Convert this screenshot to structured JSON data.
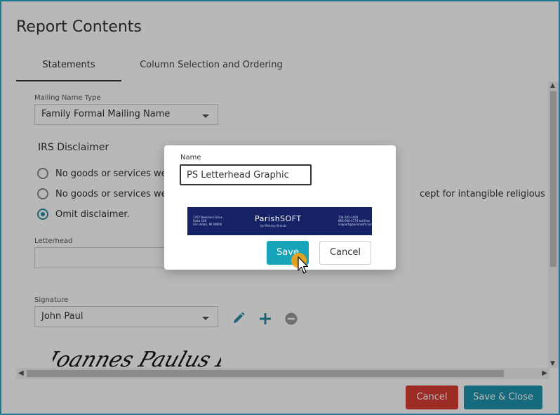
{
  "page": {
    "title": "Report Contents"
  },
  "tabs": [
    {
      "label": "Statements",
      "active": true
    },
    {
      "label": "Column Selection and Ordering",
      "active": false
    }
  ],
  "form": {
    "mailing_name_type": {
      "label": "Mailing Name Type",
      "value": "Family Formal Mailing Name"
    },
    "irs_disclaimer": {
      "title": "IRS Disclaimer",
      "options": [
        {
          "text": "No goods or services were",
          "selected": false
        },
        {
          "text": "No goods or services were",
          "trailing_text": "cept for intangible religious bene",
          "selected": false
        },
        {
          "text": "Omit disclaimer.",
          "selected": true
        }
      ]
    },
    "letterhead": {
      "label": "Letterhead"
    },
    "signature": {
      "label": "Signature",
      "value": "John Paul",
      "image_text": "Ioannes Paulus PP. II"
    }
  },
  "footer": {
    "cancel_label": "Cancel",
    "save_close_label": "Save & Close"
  },
  "modal": {
    "name_label": "Name",
    "name_value": "PS Letterhead Graphic",
    "letterhead_preview": {
      "left_text": "1767 Beechers Drive\nSuite 100\nAnn Arbor, MI 48000",
      "logo_text": "ParishSOFT",
      "tagline": "by Ministry Brands",
      "right_text": "734-205-1000\n866-930-4774 toll free\nsupport@parishsoft.com"
    },
    "save_label": "Save",
    "cancel_label": "Cancel"
  },
  "colors": {
    "accent": "#1e95ad",
    "danger": "#dc3d35",
    "letterhead_bg": "#162266",
    "cursor_highlight": "#f5a014"
  }
}
